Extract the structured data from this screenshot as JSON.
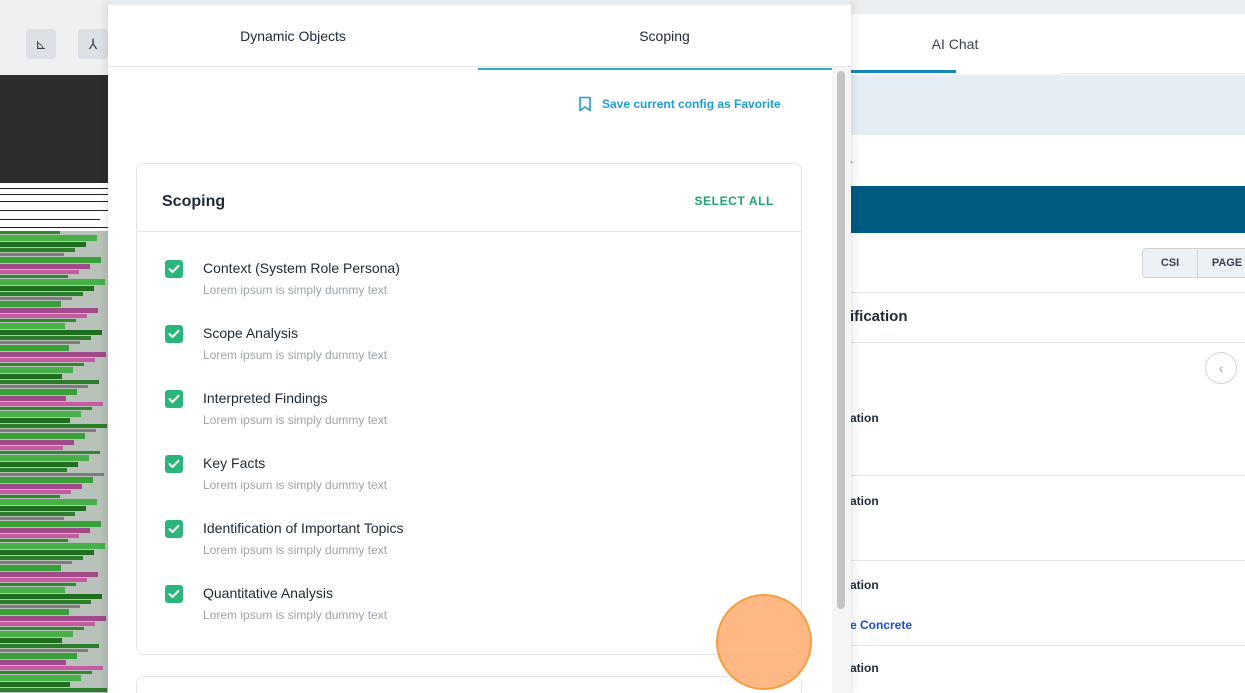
{
  "left_toolbar": {
    "tool_1_glyph": "⊾",
    "tool_2_glyph": "⅄"
  },
  "modal": {
    "tabs": [
      {
        "label": "Dynamic Objects",
        "active": false
      },
      {
        "label": "Scoping",
        "active": true
      }
    ],
    "favorite": {
      "label": "Save current config as Favorite",
      "icon": "bookmark-icon"
    },
    "scoping_card": {
      "title": "Scoping",
      "select_all_label": "SELECT ALL",
      "items": [
        {
          "title": "Context (System Role Persona)",
          "description": "Lorem ipsum is simply dummy text",
          "checked": true
        },
        {
          "title": "Scope Analysis",
          "description": "Lorem ipsum is simply dummy text",
          "checked": true
        },
        {
          "title": "Interpreted Findings",
          "description": "Lorem ipsum is simply dummy text",
          "checked": true
        },
        {
          "title": "Key Facts",
          "description": "Lorem ipsum is simply dummy text",
          "checked": true
        },
        {
          "title": "Identification of Important Topics",
          "description": "Lorem ipsum is simply dummy text",
          "checked": true
        },
        {
          "title": "Quantitative Analysis",
          "description": "Lorem ipsum is simply dummy text",
          "checked": true
        }
      ]
    }
  },
  "right_panel": {
    "tab_label": "AI Chat",
    "dot_text": ".",
    "pills": [
      "CSI",
      "PAGE"
    ],
    "heading": "ification",
    "circle_button_glyph": "‹",
    "items": [
      "ation",
      "ation",
      "ation",
      "ation"
    ],
    "link_text": "e Concrete"
  },
  "colors": {
    "accent_teal": "#36a7c9",
    "favorite_blue": "#1f9fd0",
    "check_green": "#2bb57a",
    "select_all_green": "#1ea46e",
    "right_blue_band": "#005b82",
    "click_indicator": "#f59e42"
  }
}
